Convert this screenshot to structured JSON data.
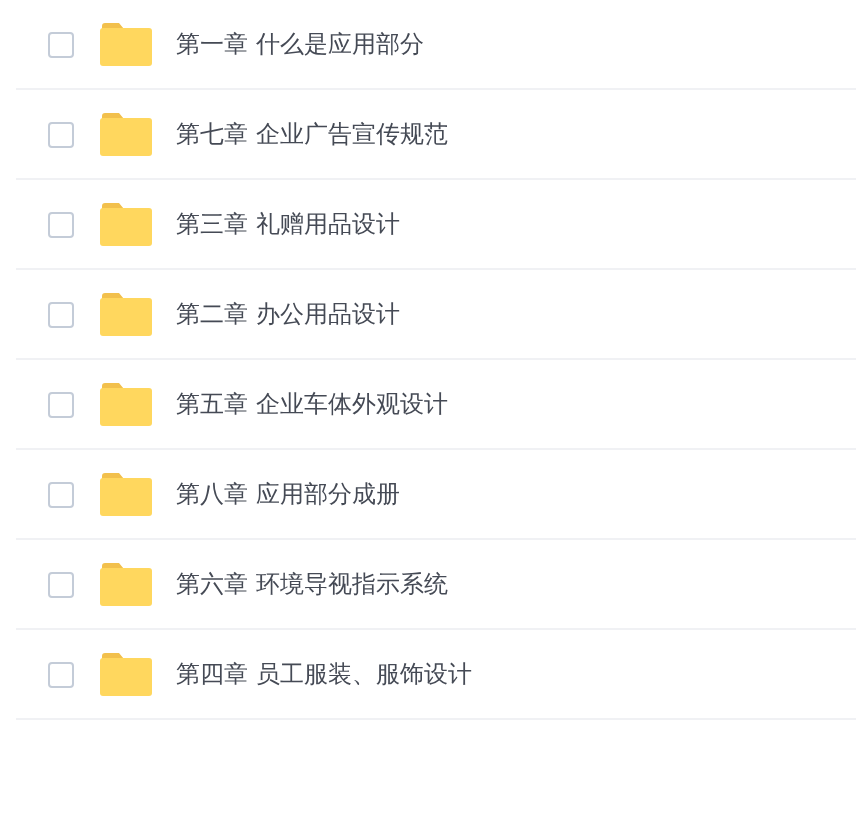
{
  "files": [
    {
      "name": "第一章 什么是应用部分",
      "checked": false
    },
    {
      "name": "第七章 企业广告宣传规范",
      "checked": false
    },
    {
      "name": "第三章 礼赠用品设计",
      "checked": false
    },
    {
      "name": "第二章 办公用品设计",
      "checked": false
    },
    {
      "name": "第五章 企业车体外观设计",
      "checked": false
    },
    {
      "name": "第八章 应用部分成册",
      "checked": false
    },
    {
      "name": "第六章 环境导视指示系统",
      "checked": false
    },
    {
      "name": "第四章 员工服装、服饰设计",
      "checked": false
    }
  ]
}
